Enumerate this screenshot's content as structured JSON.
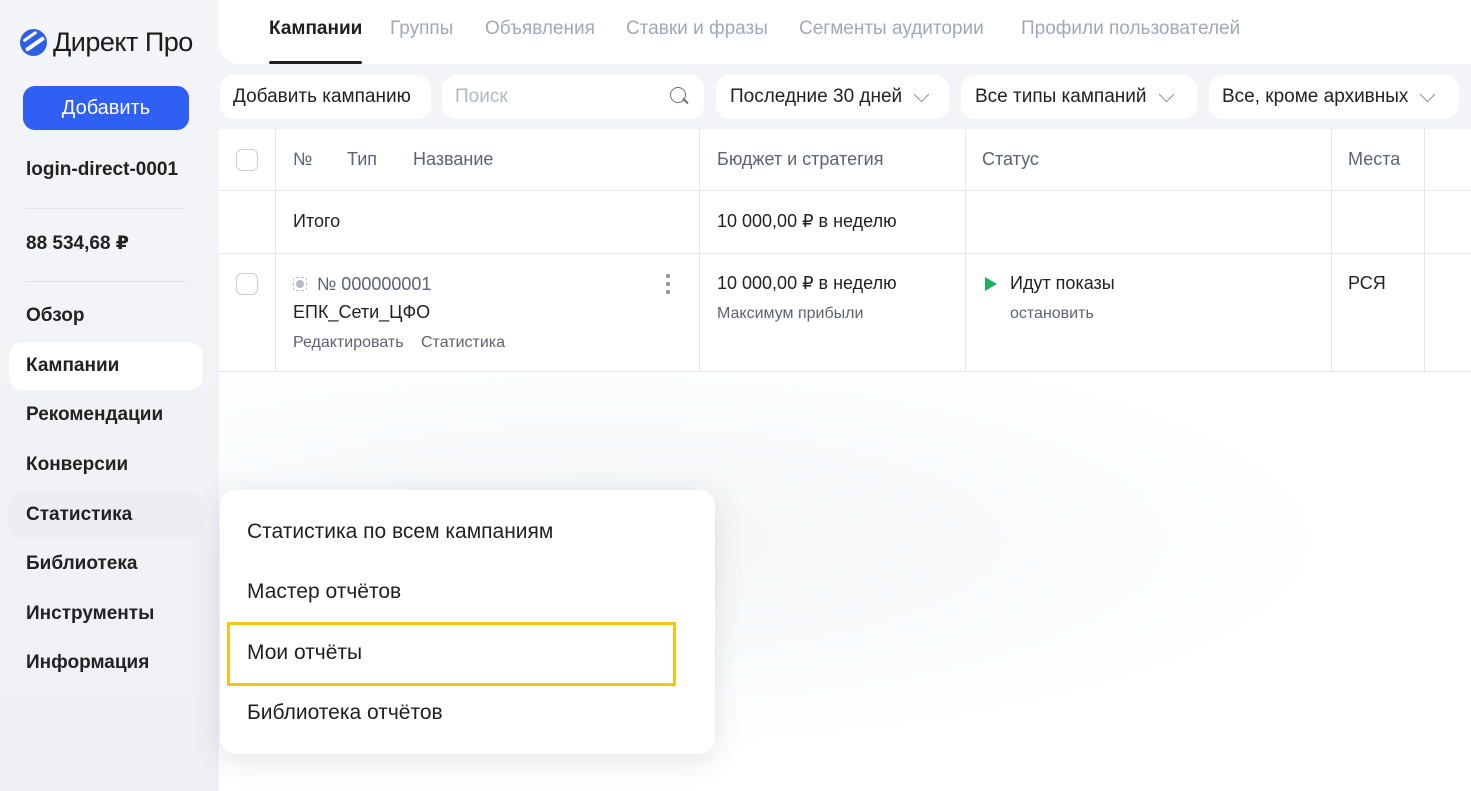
{
  "sidebar": {
    "logo": "Директ Про",
    "add_button": "Добавить",
    "login": "login-direct-0001",
    "balance": "88 534,68 ₽",
    "items": [
      {
        "label": "Обзор"
      },
      {
        "label": "Кампании"
      },
      {
        "label": "Рекомендации"
      },
      {
        "label": "Конверсии"
      },
      {
        "label": "Статистика"
      },
      {
        "label": "Библиотека"
      },
      {
        "label": "Инструменты"
      },
      {
        "label": "Информация"
      }
    ]
  },
  "tabs": [
    {
      "label": "Кампании"
    },
    {
      "label": "Группы"
    },
    {
      "label": "Объявления"
    },
    {
      "label": "Ставки и фразы"
    },
    {
      "label": "Сегменты аудитории"
    },
    {
      "label": "Профили пользователей"
    }
  ],
  "filters": {
    "add_campaign": "Добавить кампанию",
    "search_placeholder": "Поиск",
    "period": "Последние 30 дней",
    "campaign_types": "Все типы кампаний",
    "archive": "Все, кроме архивных"
  },
  "table": {
    "headers": {
      "number": "№",
      "type": "Тип",
      "name": "Название",
      "budget": "Бюджет и стратегия",
      "status": "Статус",
      "places": "Места"
    },
    "total": {
      "label": "Итого",
      "budget": "10 000,00 ₽ в неделю"
    },
    "rows": [
      {
        "number": "№ 000000001",
        "name": "ЕПК_Сети_ЦФО",
        "edit": "Редактировать",
        "stats": "Статистика",
        "budget": "10 000,00 ₽ в неделю",
        "strategy": "Максимум прибыли",
        "status": "Идут показы",
        "status_action": "остановить",
        "places": "РСЯ"
      }
    ]
  },
  "menu": {
    "items": [
      {
        "label": "Статистика по всем кампаниям"
      },
      {
        "label": "Мастер отчётов"
      },
      {
        "label": "Мои отчёты"
      },
      {
        "label": "Библиотека отчётов"
      }
    ]
  }
}
